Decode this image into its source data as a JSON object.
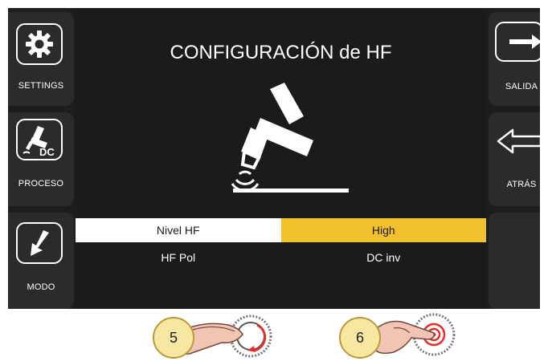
{
  "screen": {
    "title": "CONFIGURACIÓN de HF"
  },
  "left_buttons": [
    {
      "label": "SETTINGS",
      "icon": "gear-icon"
    },
    {
      "label": "PROCESO",
      "icon": "torch-dc-icon",
      "icon_text": "DC"
    },
    {
      "label": "MODO",
      "icon": "arrow-down-left-icon"
    }
  ],
  "right_buttons": [
    {
      "label": "SALIDA",
      "icon": "exit-arrow-icon"
    },
    {
      "label": "ATRÁS",
      "icon": "back-arrow-icon"
    }
  ],
  "settings": [
    {
      "name": "Nivel HF",
      "value": "High",
      "selected": true
    },
    {
      "name": "HF Pol",
      "value": "DC inv",
      "selected": false
    }
  ],
  "instructions": [
    {
      "step": "5",
      "action": "rotate-knob"
    },
    {
      "step": "6",
      "action": "press-knob"
    }
  ],
  "colors": {
    "accent": "#f2c12e",
    "selected_row": "#ffffff",
    "background": "#1b1b1b",
    "side_button": "#2b2b2b"
  }
}
